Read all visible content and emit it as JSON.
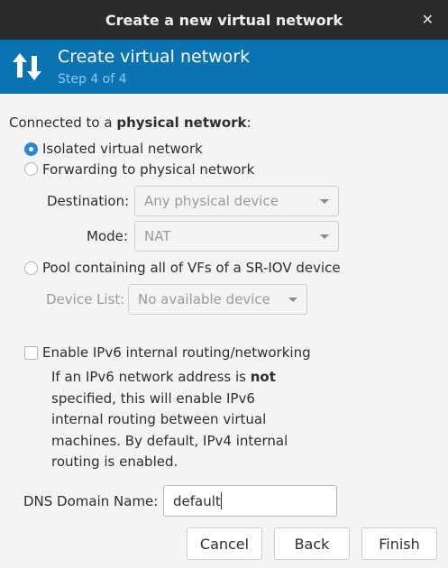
{
  "window": {
    "title": "Create a new virtual network",
    "close_glyph": "✕"
  },
  "banner": {
    "title": "Create virtual network",
    "step": "Step 4 of 4",
    "icon": "network-arrows-icon",
    "background": "#0a74b3"
  },
  "connected": {
    "prefix": "Connected to a ",
    "bold": "physical network",
    "suffix": ":"
  },
  "options": {
    "isolated": {
      "label": "Isolated virtual network",
      "selected": true
    },
    "forwarding": {
      "label": "Forwarding to physical network",
      "selected": false
    },
    "destination": {
      "label": "Destination:",
      "value": "Any physical device"
    },
    "mode": {
      "label": "Mode:",
      "value": "NAT"
    },
    "pool": {
      "label": "Pool containing all of VFs of a SR-IOV device",
      "selected": false
    },
    "device_list": {
      "label": "Device List:",
      "value": "No available device"
    }
  },
  "ipv6": {
    "label": "Enable IPv6 internal routing/networking",
    "checked": false,
    "desc_prefix": "If an IPv6 network address is ",
    "desc_bold": "not",
    "desc_suffix": " specified, this will enable IPv6 internal routing between virtual machines.  By default, IPv4 internal routing is enabled."
  },
  "dns": {
    "label": "DNS Domain Name:",
    "value": "default"
  },
  "buttons": {
    "cancel": "Cancel",
    "back": "Back",
    "finish": "Finish"
  }
}
